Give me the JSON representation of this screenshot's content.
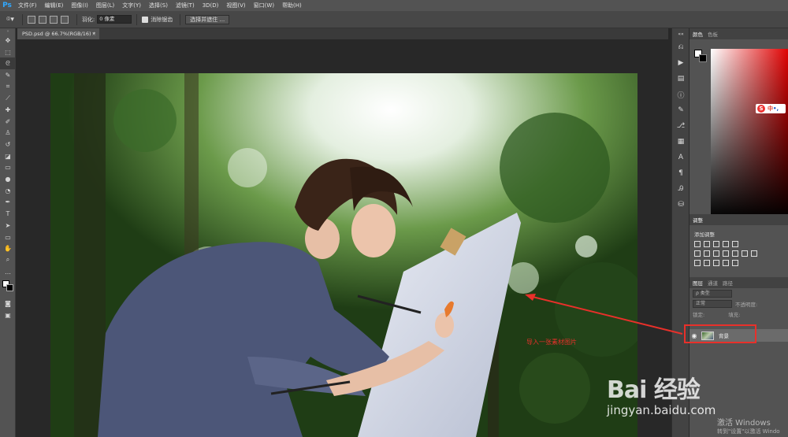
{
  "app": {
    "logo": "Ps"
  },
  "menu": [
    "文件(F)",
    "编辑(E)",
    "图像(I)",
    "图层(L)",
    "文字(Y)",
    "选择(S)",
    "滤镜(T)",
    "3D(D)",
    "视图(V)",
    "窗口(W)",
    "帮助(H)"
  ],
  "options": {
    "feather_label": "羽化:",
    "feather_value": "0 像素",
    "antialias_label": "消除锯齿",
    "select_mask_button": "选择并遮住 ..."
  },
  "document": {
    "tab_title": "PSD.psd @ 66.7%(RGB/16) *",
    "close": "×"
  },
  "panels": {
    "color_tabs": [
      "颜色",
      "色板"
    ],
    "adjust_tab": "调整",
    "adjust_title": "添加调整",
    "layer_tabs": [
      "图层",
      "通道",
      "路径"
    ],
    "kind_select": "ρ 类型",
    "blend_select": "正常",
    "opacity_label": "不透明度:",
    "lock_label": "锁定:",
    "fill_label": "填充:",
    "layer_name": "背景"
  },
  "ime": {
    "s": "S",
    "label": "中",
    "dot": "•,"
  },
  "annotation": "导入一张素材图片",
  "watermark": {
    "main": "Bai 经验",
    "sub": "jingyan.baidu.com"
  },
  "windows": {
    "line1": "激活 Windows",
    "line2": "转到\"设置\"以激活 Windo"
  },
  "colors": {
    "annotation_red": "#e8302a",
    "ps_blue": "#31a8ff"
  }
}
